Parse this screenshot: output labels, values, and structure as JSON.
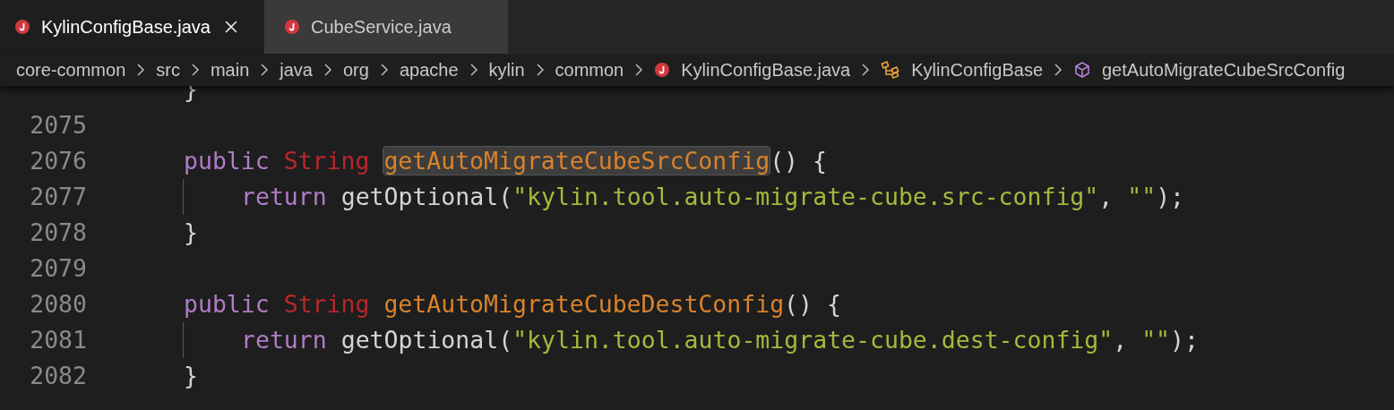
{
  "tabs": [
    {
      "label": "KylinConfigBase.java",
      "selected": true
    },
    {
      "label": "CubeService.java",
      "selected": false
    }
  ],
  "breadcrumbs": [
    {
      "kind": "folder",
      "label": "core-common"
    },
    {
      "kind": "folder",
      "label": "src"
    },
    {
      "kind": "folder",
      "label": "main"
    },
    {
      "kind": "folder",
      "label": "java"
    },
    {
      "kind": "folder",
      "label": "org"
    },
    {
      "kind": "folder",
      "label": "apache"
    },
    {
      "kind": "folder",
      "label": "kylin"
    },
    {
      "kind": "folder",
      "label": "common"
    },
    {
      "kind": "file",
      "label": "KylinConfigBase.java"
    },
    {
      "kind": "class",
      "label": "KylinConfigBase"
    },
    {
      "kind": "method",
      "label": "getAutoMigrateCubeSrcConfig"
    }
  ],
  "code_lines": [
    {
      "kind": "member",
      "guide": false,
      "tokens": [
        {
          "kind": "plain",
          "text": "}"
        }
      ]
    },
    {
      "kind": "blank",
      "number": "2075",
      "guide": false
    },
    {
      "kind": "member",
      "number": "2076",
      "guide": false,
      "tokens": [
        {
          "kind": "keyword",
          "text": "public "
        },
        {
          "kind": "type",
          "text": "String "
        },
        {
          "kind": "method",
          "text": "getAutoMigrateCubeSrcConfig",
          "highlighted": true
        },
        {
          "kind": "plain",
          "text": "() {"
        }
      ]
    },
    {
      "kind": "body",
      "number": "2077",
      "guide": true,
      "tokens": [
        {
          "kind": "keyword",
          "text": "return "
        },
        {
          "kind": "plain",
          "text": "getOptional("
        },
        {
          "kind": "string",
          "text": "\"kylin.tool.auto-migrate-cube.src-config\""
        },
        {
          "kind": "plain",
          "text": ", "
        },
        {
          "kind": "string",
          "text": "\"\""
        },
        {
          "kind": "plain",
          "text": ");"
        }
      ]
    },
    {
      "kind": "member",
      "number": "2078",
      "guide": false,
      "tokens": [
        {
          "kind": "plain",
          "text": "}"
        }
      ]
    },
    {
      "kind": "blank",
      "number": "2079",
      "guide": false
    },
    {
      "kind": "member",
      "number": "2080",
      "guide": false,
      "tokens": [
        {
          "kind": "keyword",
          "text": "public "
        },
        {
          "kind": "type",
          "text": "String "
        },
        {
          "kind": "method",
          "text": "getAutoMigrateCubeDestConfig",
          "highlighted": false
        },
        {
          "kind": "plain",
          "text": "() {"
        }
      ]
    },
    {
      "kind": "body",
      "number": "2081",
      "guide": true,
      "tokens": [
        {
          "kind": "keyword",
          "text": "return "
        },
        {
          "kind": "plain",
          "text": "getOptional("
        },
        {
          "kind": "string",
          "text": "\"kylin.tool.auto-migrate-cube.dest-config\""
        },
        {
          "kind": "plain",
          "text": ", "
        },
        {
          "kind": "string",
          "text": "\"\""
        },
        {
          "kind": "plain",
          "text": ");"
        }
      ]
    },
    {
      "kind": "member",
      "number": "2082",
      "guide": false,
      "tokens": [
        {
          "kind": "plain",
          "text": "}"
        }
      ]
    }
  ]
}
